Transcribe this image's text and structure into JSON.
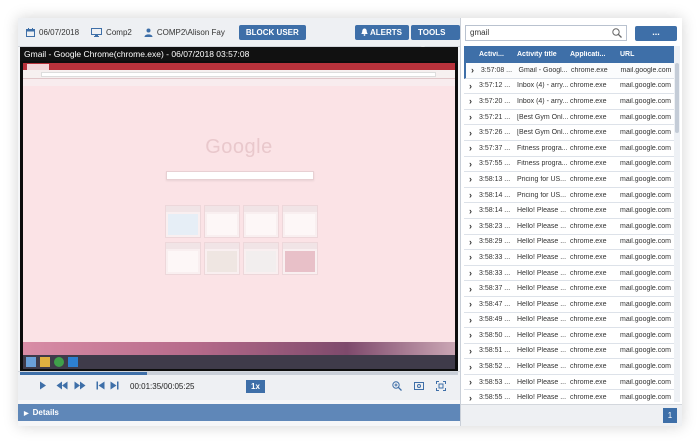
{
  "topbar": {
    "date": "06/07/2018",
    "computer": "Comp2",
    "user": "COMP2\\Alison Fay",
    "block_user_label": "BLOCK USER",
    "alerts_label": "ALERTS",
    "tools_label": "TOOLS"
  },
  "video": {
    "title": "Gmail - Google Chrome(chrome.exe) - 06/07/2018 03:57:08",
    "logo_text": "Google"
  },
  "player": {
    "timecode": "00:01:35/00:05:25",
    "speed_label": "1x",
    "progress": 0.29
  },
  "details_label": "Details",
  "search": {
    "value": "gmail"
  },
  "more_button_label": "...",
  "table": {
    "headers": [
      "Activi...",
      "Activity title",
      "Applicati...",
      "URL"
    ],
    "rows": [
      [
        "3:57:08 ...",
        "Gmail - Googl...",
        "chrome.exe",
        "mail.google.com"
      ],
      [
        "3:57:12 ...",
        "Inbox (4) - arry...",
        "chrome.exe",
        "mail.google.com"
      ],
      [
        "3:57:20 ...",
        "Inbox (4) - arry...",
        "chrome.exe",
        "mail.google.com"
      ],
      [
        "3:57:21 ...",
        "[Best Gym Onl...",
        "chrome.exe",
        "mail.google.com"
      ],
      [
        "3:57:26 ...",
        "[Best Gym Onl...",
        "chrome.exe",
        "mail.google.com"
      ],
      [
        "3:57:37 ...",
        "Fitness progra...",
        "chrome.exe",
        "mail.google.com"
      ],
      [
        "3:57:55 ...",
        "Fitness progra...",
        "chrome.exe",
        "mail.google.com"
      ],
      [
        "3:58:13 ...",
        "Pricing for US...",
        "chrome.exe",
        "mail.google.com"
      ],
      [
        "3:58:14 ...",
        "Pricing for US...",
        "chrome.exe",
        "mail.google.com"
      ],
      [
        "3:58:14 ...",
        "Hello! Please ...",
        "chrome.exe",
        "mail.google.com"
      ],
      [
        "3:58:23 ...",
        "Hello! Please ...",
        "chrome.exe",
        "mail.google.com"
      ],
      [
        "3:58:29 ...",
        "Hello! Please ...",
        "chrome.exe",
        "mail.google.com"
      ],
      [
        "3:58:33 ...",
        "Hello! Please ...",
        "chrome.exe",
        "mail.google.com"
      ],
      [
        "3:58:33 ...",
        "Hello! Please ...",
        "chrome.exe",
        "mail.google.com"
      ],
      [
        "3:58:37 ...",
        "Hello! Please ...",
        "chrome.exe",
        "mail.google.com"
      ],
      [
        "3:58:47 ...",
        "Hello! Please ...",
        "chrome.exe",
        "mail.google.com"
      ],
      [
        "3:58:49 ...",
        "Hello! Please ...",
        "chrome.exe",
        "mail.google.com"
      ],
      [
        "3:58:50 ...",
        "Hello! Please ...",
        "chrome.exe",
        "mail.google.com"
      ],
      [
        "3:58:51 ...",
        "Hello! Please ...",
        "chrome.exe",
        "mail.google.com"
      ],
      [
        "3:58:52 ...",
        "Hello! Please ...",
        "chrome.exe",
        "mail.google.com"
      ],
      [
        "3:58:53 ...",
        "Hello! Please ...",
        "chrome.exe",
        "mail.google.com"
      ],
      [
        "3:58:55 ...",
        "Hello! Please ...",
        "chrome.exe",
        "mail.google.com"
      ]
    ]
  },
  "pager": {
    "current_page": "1"
  },
  "colors": {
    "accent": "#3e6fa8",
    "details_bar": "#5f87b8"
  }
}
